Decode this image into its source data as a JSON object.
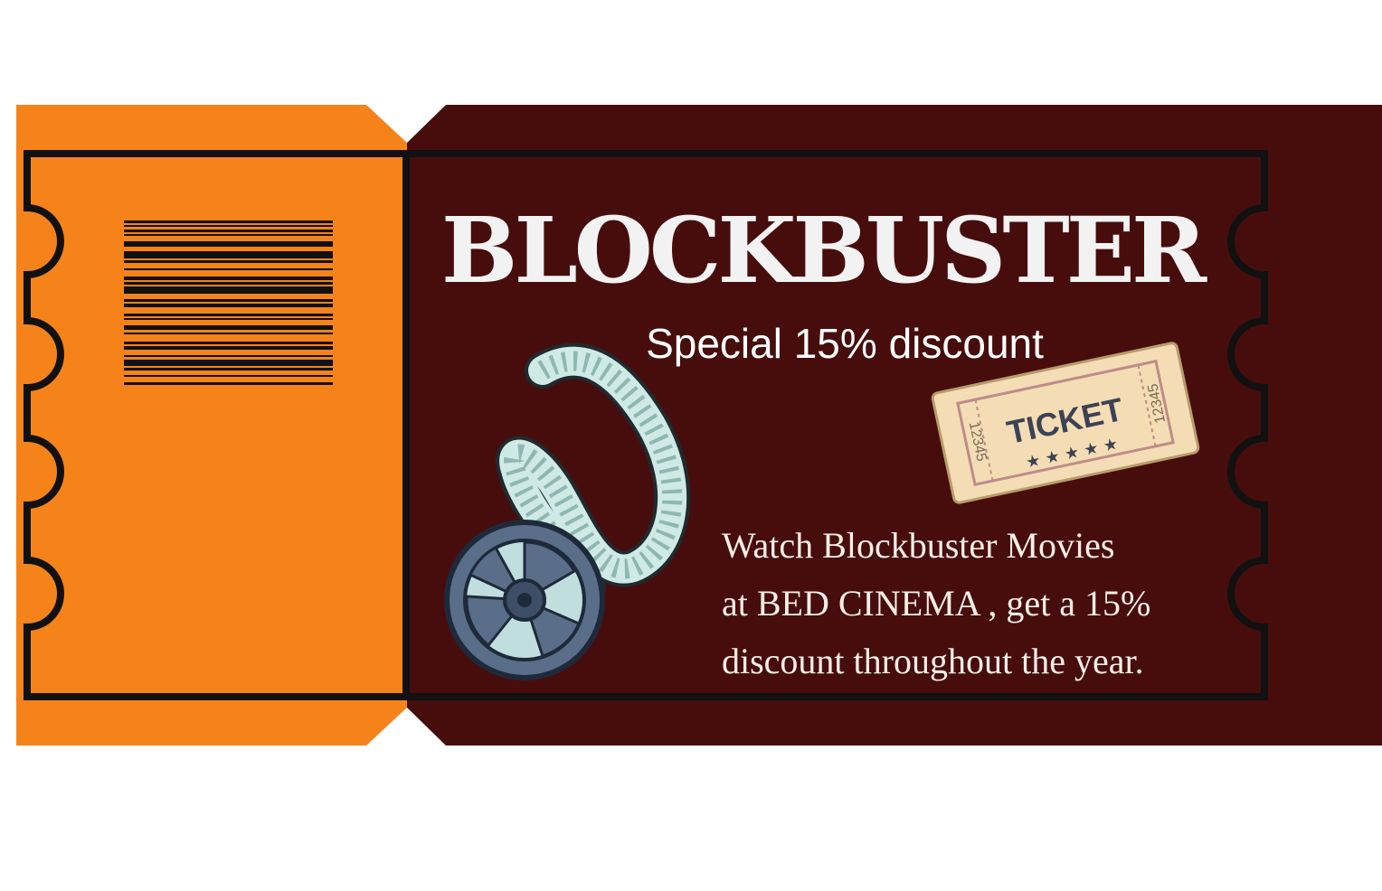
{
  "colors": {
    "stub": "#f5831a",
    "body": "#470d0d",
    "outline": "#111111",
    "film": "#cfe9e4",
    "reel": "#5a6e89",
    "mini_ticket": "#f4ddb4"
  },
  "icons": [
    "barcode-icon",
    "film-reel-icon",
    "film-strip-icon",
    "admit-ticket-icon"
  ],
  "headline": "BLOCKBUSTER",
  "subline": "Special 15% discount",
  "mini_ticket": {
    "label": "TICKET",
    "serial_left": "12345",
    "serial_right": "12345",
    "stars": "★ ★ ★ ★ ★"
  },
  "description": {
    "line1": "Watch Blockbuster Movies",
    "line2": "at BED CINEMA , get a 15%",
    "line3": "discount throughout the year."
  }
}
